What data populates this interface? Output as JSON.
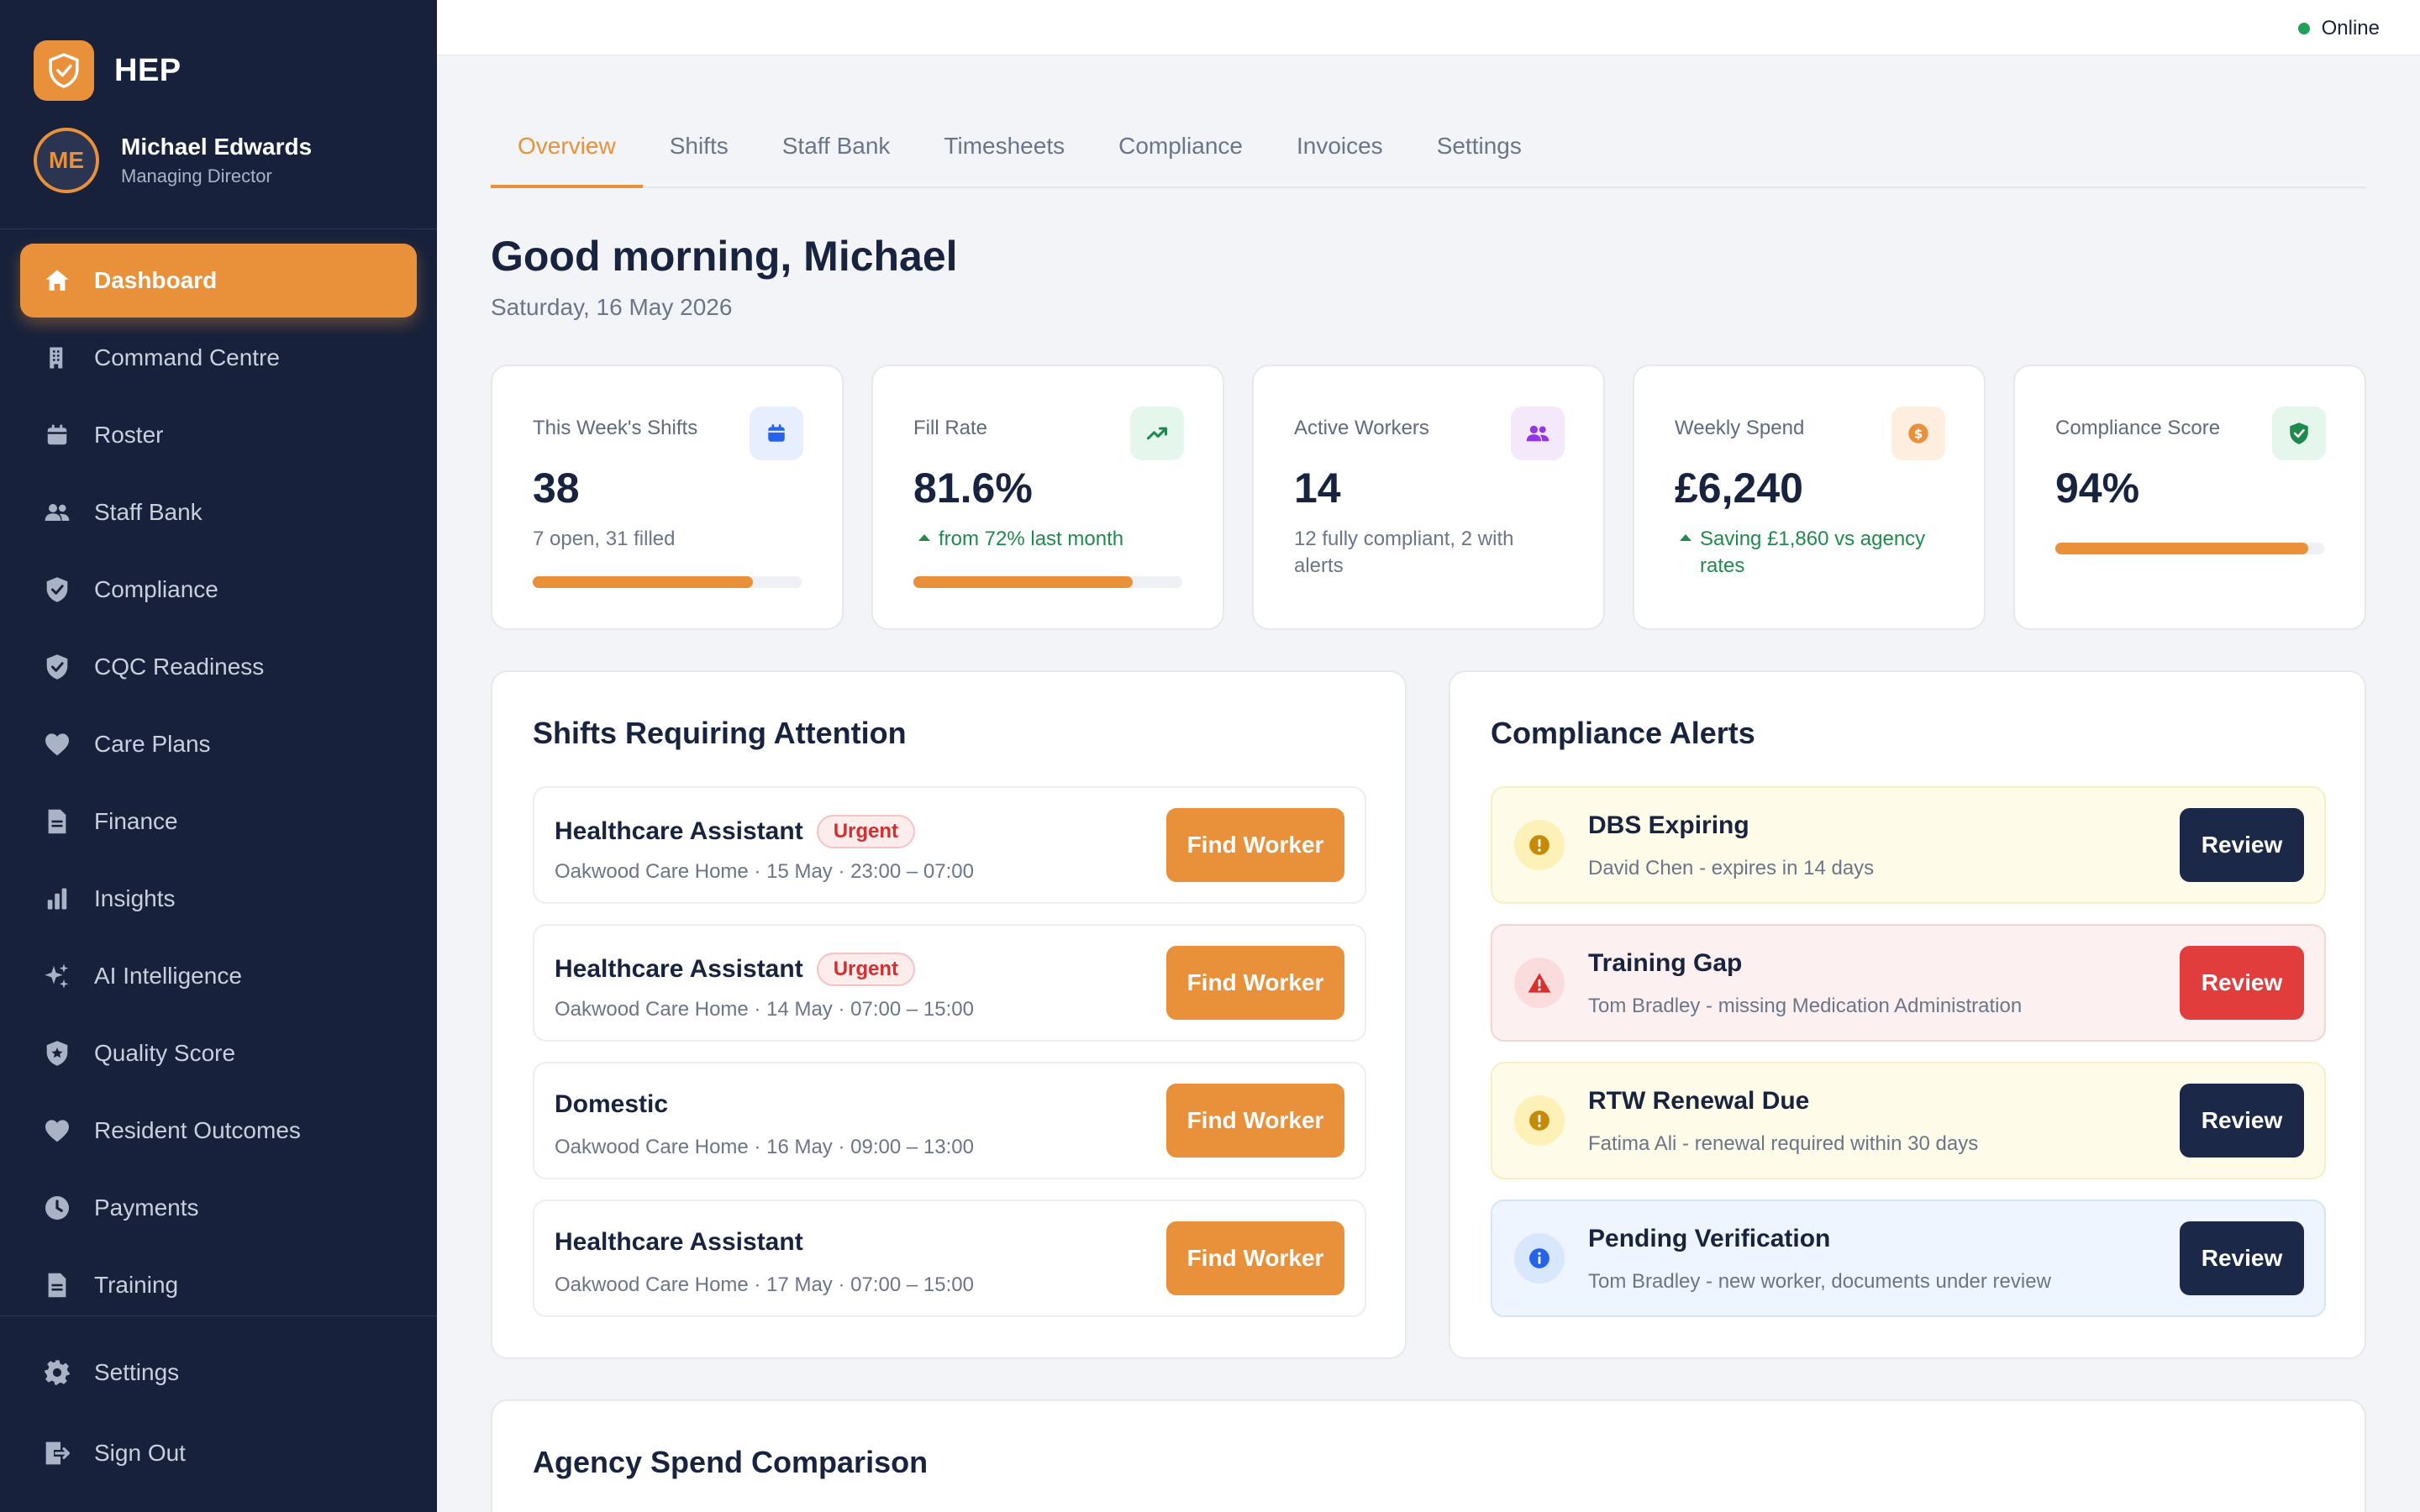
{
  "app": {
    "name": "HEP"
  },
  "user": {
    "initials": "ME",
    "name": "Michael Edwards",
    "role": "Managing Director"
  },
  "sidebar": {
    "items": [
      {
        "label": "Dashboard",
        "icon": "home-icon"
      },
      {
        "label": "Command Centre",
        "icon": "building-icon"
      },
      {
        "label": "Roster",
        "icon": "calendar-icon"
      },
      {
        "label": "Staff Bank",
        "icon": "users-icon"
      },
      {
        "label": "Compliance",
        "icon": "shield-check-icon"
      },
      {
        "label": "CQC Readiness",
        "icon": "shield-check-icon"
      },
      {
        "label": "Care Plans",
        "icon": "heart-icon"
      },
      {
        "label": "Finance",
        "icon": "document-icon"
      },
      {
        "label": "Insights",
        "icon": "bar-chart-icon"
      },
      {
        "label": "AI Intelligence",
        "icon": "sparkles-icon"
      },
      {
        "label": "Quality Score",
        "icon": "shield-star-icon"
      },
      {
        "label": "Resident Outcomes",
        "icon": "heart-icon"
      },
      {
        "label": "Payments",
        "icon": "clock-icon"
      },
      {
        "label": "Training",
        "icon": "document-icon"
      }
    ],
    "bottom": [
      {
        "label": "Settings",
        "icon": "gear-icon"
      },
      {
        "label": "Sign Out",
        "icon": "sign-out-icon"
      }
    ]
  },
  "topbar": {
    "status": "Online"
  },
  "tabs": [
    "Overview",
    "Shifts",
    "Staff Bank",
    "Timesheets",
    "Compliance",
    "Invoices",
    "Settings"
  ],
  "greeting": "Good morning, Michael",
  "date": "Saturday, 16 May 2026",
  "stats": [
    {
      "label": "This Week's Shifts",
      "value": "38",
      "sub": "7 open, 31 filled",
      "progress": 0.82,
      "icon": "calendar-icon"
    },
    {
      "label": "Fill Rate",
      "value": "81.6%",
      "sub": "from 72% last month",
      "progress": 0.816,
      "icon": "trending-up-icon"
    },
    {
      "label": "Active Workers",
      "value": "14",
      "sub": "12 fully compliant, 2 with alerts",
      "icon": "users-icon"
    },
    {
      "label": "Weekly Spend",
      "value": "£6,240",
      "sub": "Saving £1,860 vs agency rates",
      "icon": "coin-icon"
    },
    {
      "label": "Compliance Score",
      "value": "94%",
      "progress": 0.94,
      "icon": "shield-check-icon"
    }
  ],
  "shifts_panel": {
    "title": "Shifts Requiring Attention",
    "button_label": "Find Worker",
    "rows": [
      {
        "role": "Healthcare Assistant",
        "badge": "Urgent",
        "meta": "Oakwood Care Home · 15 May · 23:00 – 07:00"
      },
      {
        "role": "Healthcare Assistant",
        "badge": "Urgent",
        "meta": "Oakwood Care Home · 14 May · 07:00 – 15:00"
      },
      {
        "role": "Domestic",
        "meta": "Oakwood Care Home · 16 May · 09:00 – 13:00"
      },
      {
        "role": "Healthcare Assistant",
        "meta": "Oakwood Care Home · 17 May · 07:00 – 15:00"
      }
    ]
  },
  "compliance_panel": {
    "title": "Compliance Alerts",
    "button_label": "Review",
    "alerts": [
      {
        "title": "DBS Expiring",
        "desc": "David Chen - expires in 14 days",
        "level": "warning",
        "icon": "exclamation-icon"
      },
      {
        "title": "Training Gap",
        "desc": "Tom Bradley - missing Medication Administration",
        "level": "danger",
        "icon": "warning-triangle-icon"
      },
      {
        "title": "RTW Renewal Due",
        "desc": "Fatima Ali - renewal required within 30 days",
        "level": "warning",
        "icon": "exclamation-icon"
      },
      {
        "title": "Pending Verification",
        "desc": "Tom Bradley - new worker, documents under review",
        "level": "info",
        "icon": "info-icon"
      }
    ]
  },
  "spend_panel": {
    "title": "Agency Spend Comparison"
  },
  "colors": {
    "accent": "#e8913a",
    "sidebar": "#17213b",
    "danger": "#e23d3d",
    "success": "#1f8a4c",
    "navy": "#1c2848"
  }
}
